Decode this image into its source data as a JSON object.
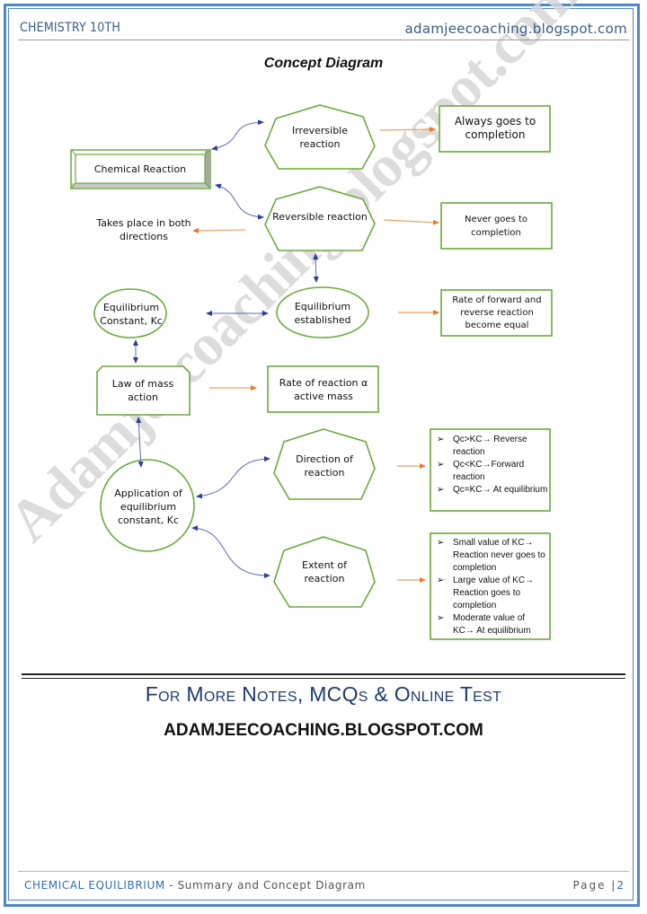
{
  "header": {
    "subject": "CHEMISTRY 10TH",
    "site": "adamjeecoaching.blogspot.com"
  },
  "title": "Concept Diagram",
  "watermark": "Adamjeecoaching.blogspot.com",
  "colors": {
    "frame": "#4f86c6",
    "shape_stroke": "#6aaa3a",
    "connector_blue": "#2e3d98",
    "connector_orange": "#f0a060",
    "promo_text": "#1f3b6e",
    "footer_chapter": "#2f6db5"
  },
  "nodes": {
    "chemical_reaction": "Chemical Reaction",
    "irreversible": "Irreversible reaction",
    "reversible": "Reversible reaction",
    "always_completion": "Always goes to completion",
    "never_completion": "Never goes to completion",
    "both_directions": "Takes place in both directions",
    "eq_constant": "Equilibrium Constant, Kc",
    "eq_established": "Equilibrium established",
    "rate_equal": "Rate of forward and reverse reaction become equal",
    "law_mass_action": "Law of mass action",
    "rate_active_mass": "Rate of reaction α active mass",
    "application": "Application of equilibrium constant, Kc",
    "direction": "Direction of reaction",
    "extent": "Extent of reaction"
  },
  "direction_list": {
    "bullet": "➢",
    "items": [
      "Qc>KC→ Reverse reaction",
      "Qc<KC→Forward reaction",
      "Qc=KC→ At equilibrium"
    ]
  },
  "extent_list": {
    "bullet": "➢",
    "items": [
      "Small value of KC→ Reaction never goes to completion",
      "Large value of KC→ Reaction goes to completion",
      "Moderate value of KC→ At equilibrium"
    ]
  },
  "promo": {
    "headline": "For More Notes, MCQs & Online Test",
    "url": "ADAMJEECOACHING.BLOGSPOT.COM"
  },
  "footer": {
    "chapter": "CHEMICAL EQUILIBRIUM",
    "separator": " - ",
    "subtitle": "Summary and Concept Diagram",
    "page_label": "Page |",
    "page_number": "2"
  }
}
